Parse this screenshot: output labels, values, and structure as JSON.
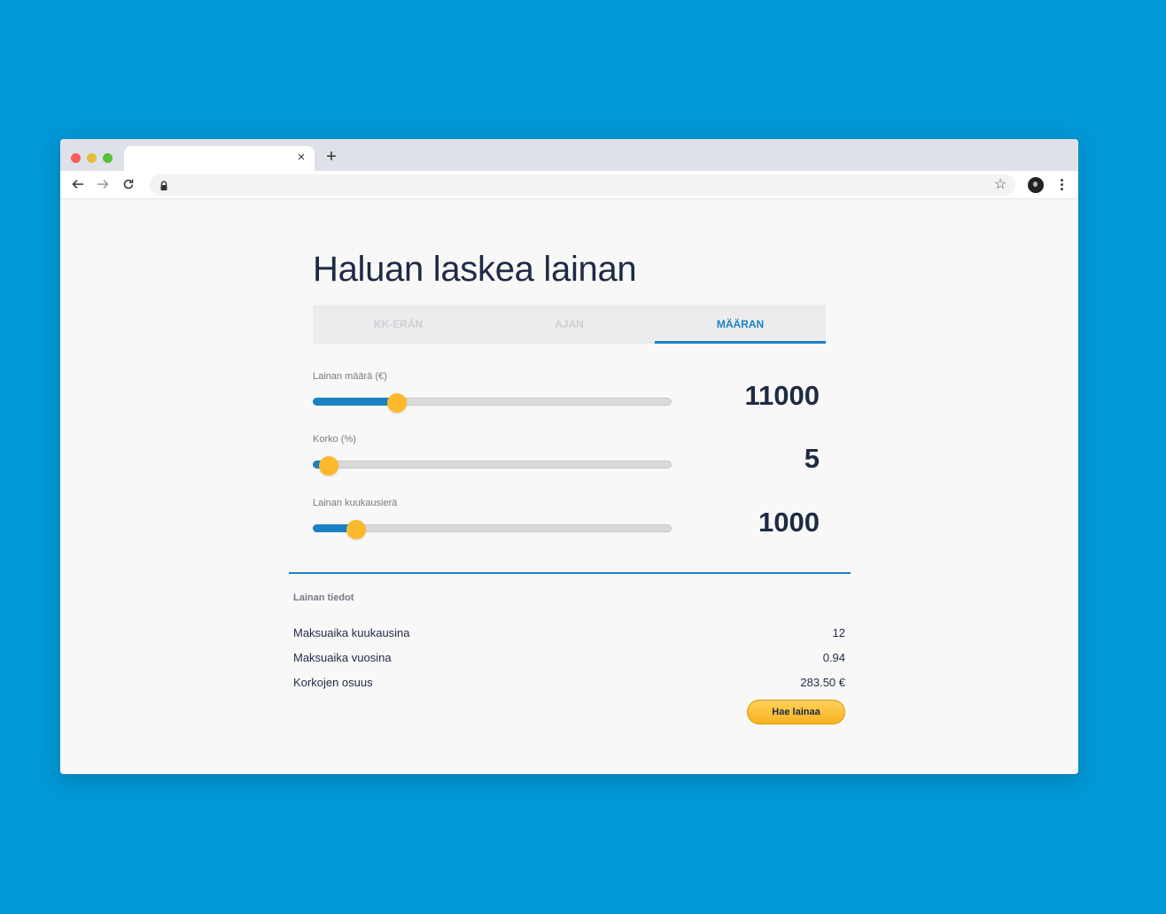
{
  "browser": {
    "tab_close_glyph": "×",
    "new_tab_glyph": "+",
    "star_glyph": "☆"
  },
  "page": {
    "title": "Haluan laskea lainan",
    "mode_tabs": [
      {
        "label": "KK-ERÄN",
        "active": false
      },
      {
        "label": "AJAN",
        "active": false
      },
      {
        "label": "MÄÄRAN",
        "active": true
      }
    ],
    "sliders": [
      {
        "label": "Lainan määrä (€)",
        "value": "11000",
        "fill_fraction": 0.235
      },
      {
        "label": "Korko (%)",
        "value": "5",
        "fill_fraction": 0.045
      },
      {
        "label": "Lainan kuukausierä",
        "value": "1000",
        "fill_fraction": 0.12
      }
    ],
    "info": {
      "heading": "Lainan tiedot",
      "rows": [
        {
          "label": "Maksuaika kuukausina",
          "value": "12"
        },
        {
          "label": "Maksuaika vuosina",
          "value": "0.94"
        },
        {
          "label": "Korkojen osuus",
          "value": "283.50 €"
        }
      ]
    },
    "apply_button": "Hae lainaa"
  },
  "colors": {
    "background": "#0098d6",
    "accent": "#1a82c4",
    "thumb": "#fdb92c",
    "text": "#1f2a44"
  }
}
